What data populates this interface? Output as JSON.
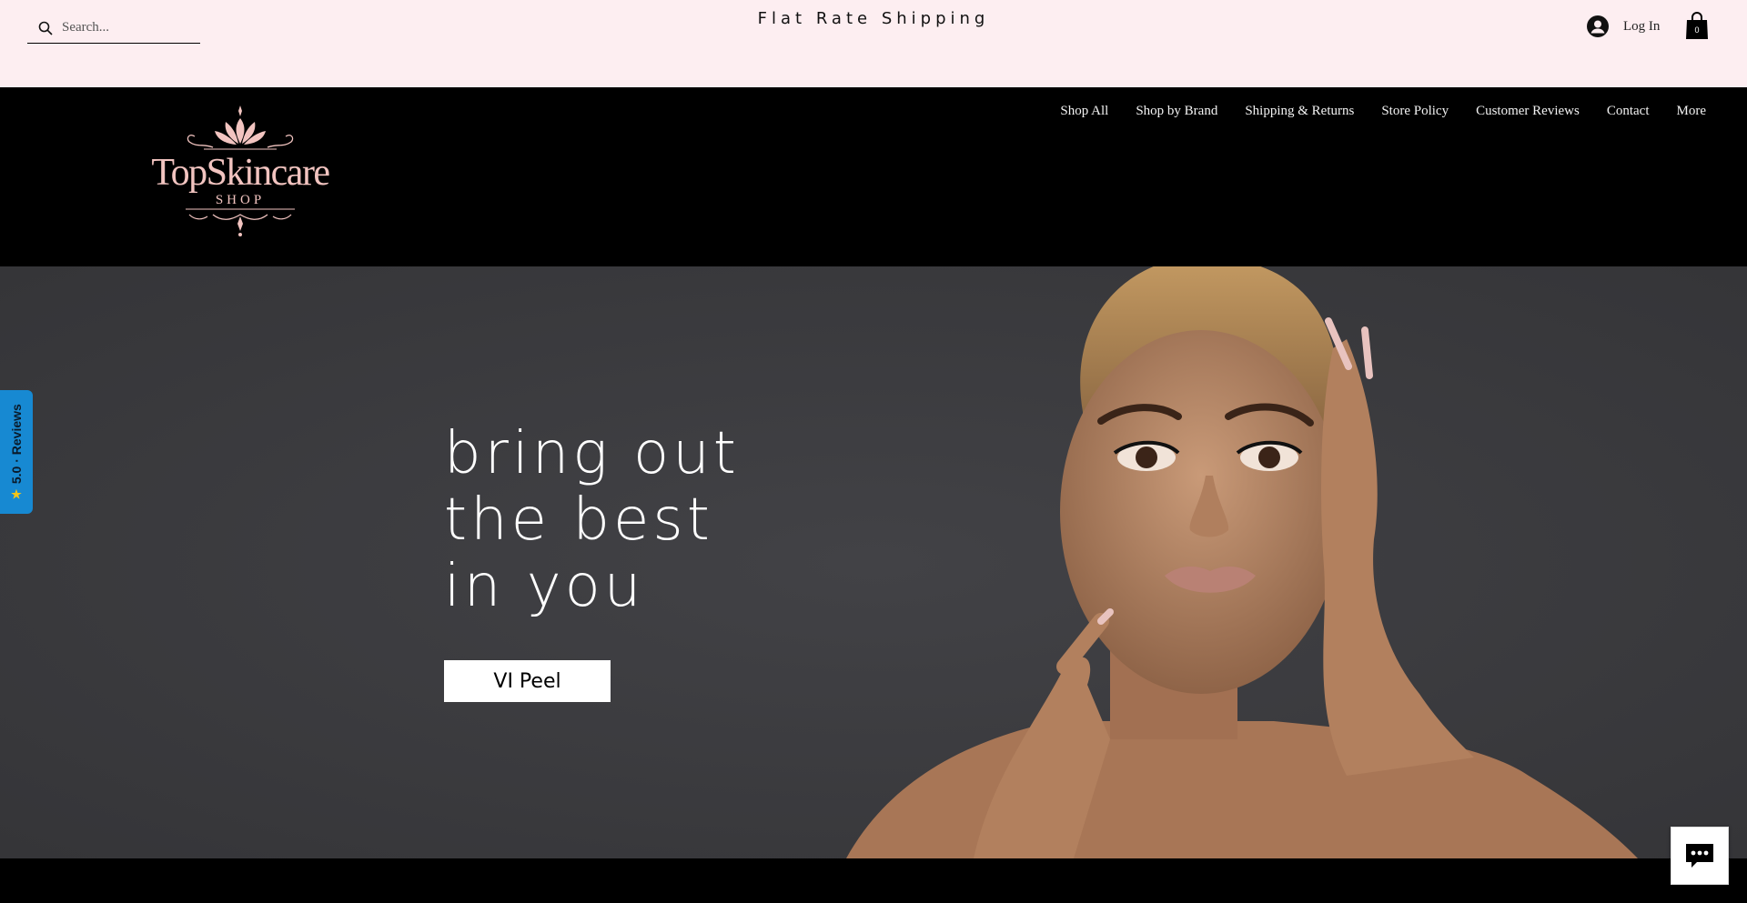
{
  "topbar": {
    "search_placeholder": "Search...",
    "announcement": "Flat Rate Shipping",
    "login_label": "Log In",
    "cart_count": "0"
  },
  "logo": {
    "line1": "TopSkincare",
    "line2": "SHOP"
  },
  "nav": {
    "items": [
      {
        "label": "Shop All"
      },
      {
        "label": "Shop by Brand"
      },
      {
        "label": "Shipping & Returns"
      },
      {
        "label": "Store Policy"
      },
      {
        "label": "Customer Reviews"
      },
      {
        "label": "Contact"
      },
      {
        "label": "More"
      }
    ]
  },
  "hero": {
    "line1": "bring out",
    "line2": "the best",
    "line3": "in you",
    "button_label": "VI Peel"
  },
  "reviews_tab": {
    "label": "5.0 · Reviews"
  },
  "colors": {
    "topbar_bg": "#fdeef1",
    "header_bg": "#000000",
    "hero_bg": "#3a3a3d",
    "accent_pink": "#f2c4c0",
    "reviews_blue": "#1789d2"
  },
  "icons": {
    "search": "search-icon",
    "login": "user-avatar-icon",
    "cart": "shopping-bag-icon",
    "chat": "chat-bubble-icon",
    "star": "star-icon"
  }
}
